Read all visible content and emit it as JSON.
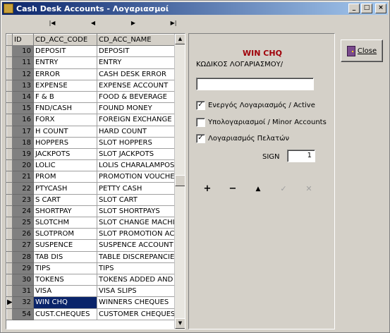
{
  "window": {
    "title": "Cash Desk Accounts - Λογαριασμοί",
    "minimize": "_",
    "maximize": "□",
    "close": "×"
  },
  "navigator": {
    "first": "|◀",
    "prior": "◀",
    "next": "▶",
    "last": "▶|"
  },
  "grid": {
    "columns": [
      "ID",
      "CD_ACC_CODE",
      "CD_ACC_NAME"
    ],
    "rows": [
      {
        "id": "10",
        "code": "DEPOSIT",
        "name": "DEPOSIT"
      },
      {
        "id": "11",
        "code": "ENTRY",
        "name": "ENTRY"
      },
      {
        "id": "12",
        "code": "ERROR",
        "name": "CASH DESK ERROR"
      },
      {
        "id": "13",
        "code": "EXPENSE",
        "name": "EXPENSE ACCOUNT"
      },
      {
        "id": "14",
        "code": "F & B",
        "name": "FOOD & BEVERAGE"
      },
      {
        "id": "15",
        "code": "FND/CASH",
        "name": "FOUND MONEY"
      },
      {
        "id": "16",
        "code": "FORX",
        "name": "FOREIGN EXCHANGE"
      },
      {
        "id": "17",
        "code": "H COUNT",
        "name": "HARD COUNT"
      },
      {
        "id": "18",
        "code": "HOPPERS",
        "name": "SLOT HOPPERS"
      },
      {
        "id": "19",
        "code": "JACKPOTS",
        "name": "SLOT JACKPOTS"
      },
      {
        "id": "20",
        "code": "LOLIC",
        "name": "LOLIS  CHARALAMPOS"
      },
      {
        "id": "21",
        "code": "PROM",
        "name": "PROMOTION VOUCHER"
      },
      {
        "id": "22",
        "code": "PTYCASH",
        "name": "PETTY CASH"
      },
      {
        "id": "23",
        "code": "S CART",
        "name": "SLOT CART"
      },
      {
        "id": "24",
        "code": "SHORTPAY",
        "name": "SLOT SHORTPAYS"
      },
      {
        "id": "25",
        "code": "SLOTCHM",
        "name": "SLOT CHANGE MACHIN"
      },
      {
        "id": "26",
        "code": "SLOTPROM",
        "name": "SLOT PROMOTION ACC"
      },
      {
        "id": "27",
        "code": "SUSPENCE",
        "name": "SUSPENCE ACCOUNT"
      },
      {
        "id": "28",
        "code": "TAB DIS",
        "name": "TABLE DISCREPANCIES"
      },
      {
        "id": "29",
        "code": "TIPS",
        "name": "TIPS"
      },
      {
        "id": "30",
        "code": "TOKENS",
        "name": "TOKENS ADDED AND R"
      },
      {
        "id": "31",
        "code": "VISA",
        "name": "VISA SLIPS"
      },
      {
        "id": "32",
        "code": "WIN CHQ",
        "name": "WINNERS CHEQUES",
        "selected": true
      },
      {
        "id": "54",
        "code": "CUST.CHEQUES",
        "name": "CUSTOMER CHEQUES"
      }
    ],
    "row_indicator": "▶"
  },
  "detail": {
    "heading": "WIN CHQ",
    "code_label": "ΚΩΔΙΚΟΣ ΛΟΓΑΡΙΑΣΜΟΥ/",
    "code_value": "",
    "active": {
      "label": "Ενεργός Λογαριασμός / Active",
      "checked": true,
      "mark": "✓"
    },
    "minor": {
      "label": "Υπολογαριασμοί / Minor Accounts",
      "checked": false,
      "mark": ""
    },
    "customers": {
      "label": "Λογαριασμός Πελατών",
      "checked": true,
      "mark": "✓"
    },
    "sign_label": "SIGN",
    "sign_value": "1",
    "toolbar": {
      "insert": "+",
      "delete": "−",
      "edit": "▲",
      "post": "✓",
      "cancel": "✕"
    }
  },
  "close_button": {
    "label": "Close"
  },
  "scrollbar": {
    "up": "▲",
    "down": "▼"
  }
}
